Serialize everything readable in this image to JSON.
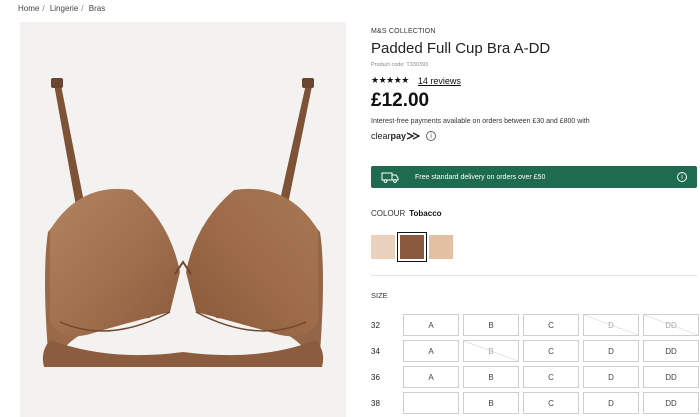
{
  "breadcrumb": [
    "Home",
    "Lingerie",
    "Bras"
  ],
  "product": {
    "brand": "M&S COLLECTION",
    "title": "Padded Full Cup Bra A-DD",
    "code": "Product code: T330393",
    "stars": "★★★★★",
    "rating_value": 5,
    "reviews": "14 reviews",
    "price": "£12.00",
    "finance_text": "Interest-free payments available on orders between £30 and £800 with",
    "clearpay_a": "clear",
    "clearpay_b": "pay",
    "info_glyph": "i"
  },
  "delivery_banner": {
    "text": "Free standard delivery on orders over £50",
    "icon": "truck-icon",
    "color": "#1f6b4f"
  },
  "colour": {
    "label": "COLOUR",
    "selected": "Tobacco",
    "swatches": [
      "#ead1bd",
      "#8a5a3e",
      "#e4c0a2"
    ]
  },
  "size": {
    "label": "SIZE",
    "rows": [
      {
        "band": "32",
        "cups": [
          "A",
          "B",
          "C",
          "D",
          "DD"
        ]
      },
      {
        "band": "34",
        "cups": [
          "A",
          "B",
          "C",
          "D",
          "DD"
        ]
      },
      {
        "band": "36",
        "cups": [
          "A",
          "B",
          "C",
          "D",
          "DD"
        ]
      },
      {
        "band": "38",
        "cups": [
          "",
          "B",
          "C",
          "D",
          "DD"
        ]
      }
    ]
  }
}
